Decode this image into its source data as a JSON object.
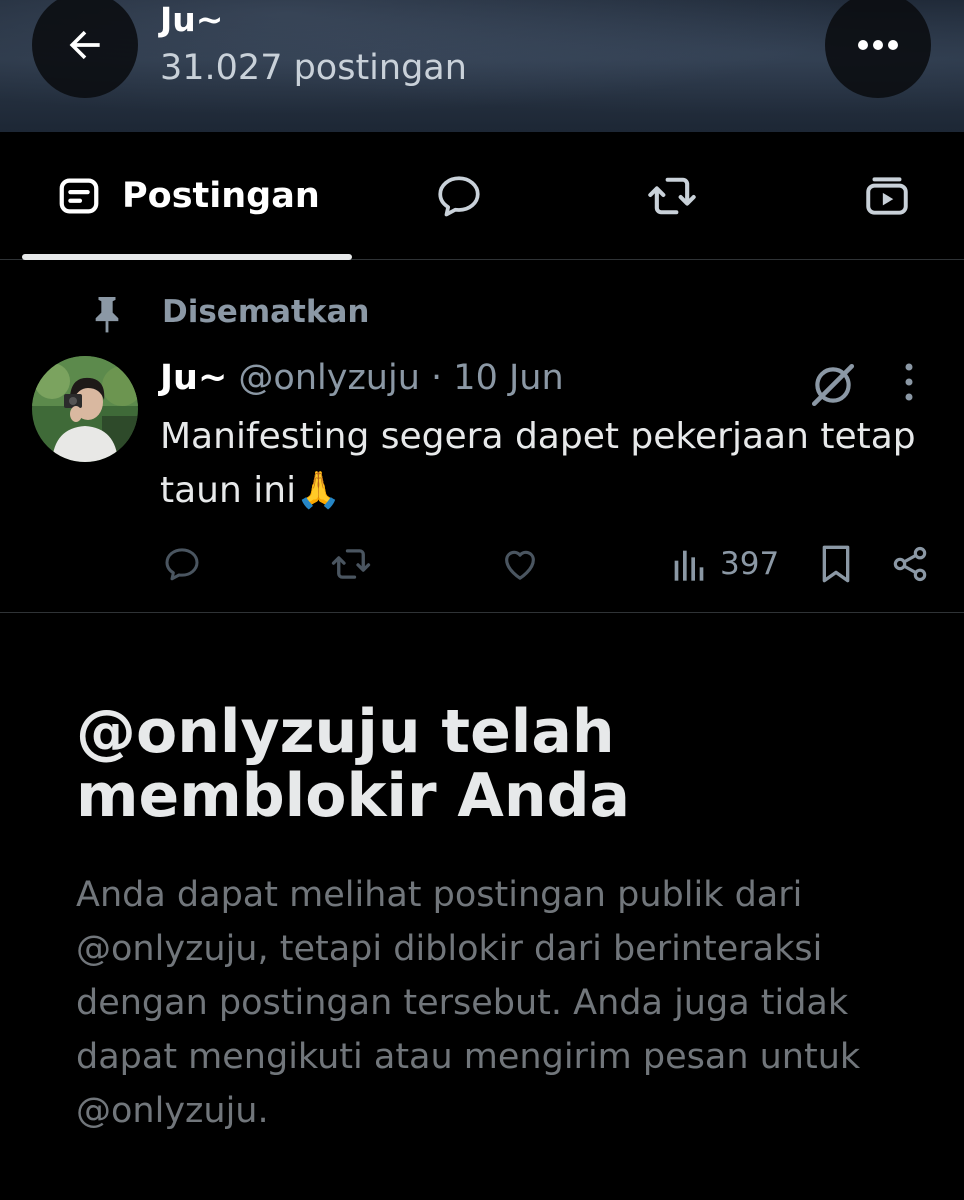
{
  "header": {
    "name": "Ju~",
    "post_count": "31.027 postingan"
  },
  "tabs": [
    {
      "label": "Postingan",
      "icon": "posts-icon",
      "active": true
    },
    {
      "label": "",
      "icon": "replies-icon"
    },
    {
      "label": "",
      "icon": "repost-icon"
    },
    {
      "label": "",
      "icon": "media-icon"
    }
  ],
  "pinned": {
    "label": "Disematkan"
  },
  "tweet": {
    "name": "Ju~",
    "handle": "@onlyzuju",
    "separator": " · ",
    "date": "10 Jun",
    "text": "Manifesting segera dapet pekerjaan tetap taun ini🙏",
    "views": "397"
  },
  "blocked": {
    "title": "@onlyzuju telah memblokir Anda",
    "description": "Anda dapat melihat postingan publik dari @onlyzuju, tetapi diblokir dari berinteraksi dengan postingan tersebut. Anda juga tidak dapat mengikuti atau mengirim pesan untuk @onlyzuju."
  },
  "colors": {
    "background": "#000000",
    "text_primary": "#e7e9ea",
    "text_secondary": "#8b98a5",
    "divider": "#2f3336"
  }
}
